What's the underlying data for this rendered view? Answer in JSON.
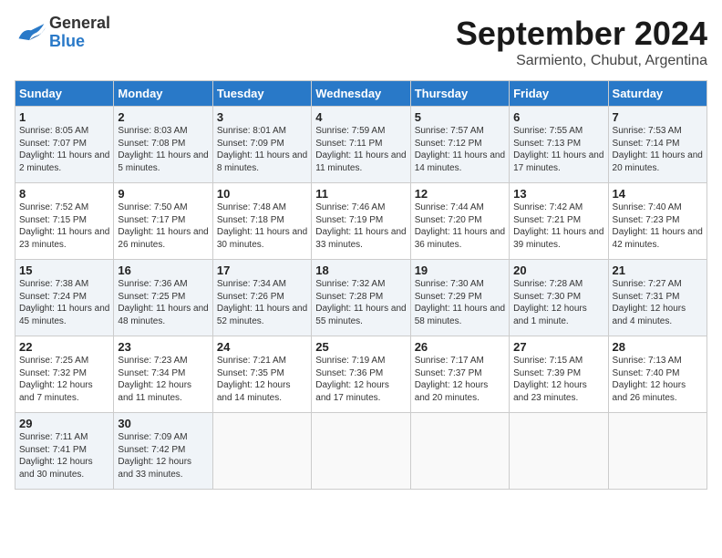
{
  "header": {
    "logo_general": "General",
    "logo_blue": "Blue",
    "month": "September 2024",
    "location": "Sarmiento, Chubut, Argentina"
  },
  "columns": [
    "Sunday",
    "Monday",
    "Tuesday",
    "Wednesday",
    "Thursday",
    "Friday",
    "Saturday"
  ],
  "weeks": [
    [
      {
        "day": "1",
        "sunrise": "8:05 AM",
        "sunset": "7:07 PM",
        "daylight": "11 hours and 2 minutes."
      },
      {
        "day": "2",
        "sunrise": "8:03 AM",
        "sunset": "7:08 PM",
        "daylight": "11 hours and 5 minutes."
      },
      {
        "day": "3",
        "sunrise": "8:01 AM",
        "sunset": "7:09 PM",
        "daylight": "11 hours and 8 minutes."
      },
      {
        "day": "4",
        "sunrise": "7:59 AM",
        "sunset": "7:11 PM",
        "daylight": "11 hours and 11 minutes."
      },
      {
        "day": "5",
        "sunrise": "7:57 AM",
        "sunset": "7:12 PM",
        "daylight": "11 hours and 14 minutes."
      },
      {
        "day": "6",
        "sunrise": "7:55 AM",
        "sunset": "7:13 PM",
        "daylight": "11 hours and 17 minutes."
      },
      {
        "day": "7",
        "sunrise": "7:53 AM",
        "sunset": "7:14 PM",
        "daylight": "11 hours and 20 minutes."
      }
    ],
    [
      {
        "day": "8",
        "sunrise": "7:52 AM",
        "sunset": "7:15 PM",
        "daylight": "11 hours and 23 minutes."
      },
      {
        "day": "9",
        "sunrise": "7:50 AM",
        "sunset": "7:17 PM",
        "daylight": "11 hours and 26 minutes."
      },
      {
        "day": "10",
        "sunrise": "7:48 AM",
        "sunset": "7:18 PM",
        "daylight": "11 hours and 30 minutes."
      },
      {
        "day": "11",
        "sunrise": "7:46 AM",
        "sunset": "7:19 PM",
        "daylight": "11 hours and 33 minutes."
      },
      {
        "day": "12",
        "sunrise": "7:44 AM",
        "sunset": "7:20 PM",
        "daylight": "11 hours and 36 minutes."
      },
      {
        "day": "13",
        "sunrise": "7:42 AM",
        "sunset": "7:21 PM",
        "daylight": "11 hours and 39 minutes."
      },
      {
        "day": "14",
        "sunrise": "7:40 AM",
        "sunset": "7:23 PM",
        "daylight": "11 hours and 42 minutes."
      }
    ],
    [
      {
        "day": "15",
        "sunrise": "7:38 AM",
        "sunset": "7:24 PM",
        "daylight": "11 hours and 45 minutes."
      },
      {
        "day": "16",
        "sunrise": "7:36 AM",
        "sunset": "7:25 PM",
        "daylight": "11 hours and 48 minutes."
      },
      {
        "day": "17",
        "sunrise": "7:34 AM",
        "sunset": "7:26 PM",
        "daylight": "11 hours and 52 minutes."
      },
      {
        "day": "18",
        "sunrise": "7:32 AM",
        "sunset": "7:28 PM",
        "daylight": "11 hours and 55 minutes."
      },
      {
        "day": "19",
        "sunrise": "7:30 AM",
        "sunset": "7:29 PM",
        "daylight": "11 hours and 58 minutes."
      },
      {
        "day": "20",
        "sunrise": "7:28 AM",
        "sunset": "7:30 PM",
        "daylight": "12 hours and 1 minute."
      },
      {
        "day": "21",
        "sunrise": "7:27 AM",
        "sunset": "7:31 PM",
        "daylight": "12 hours and 4 minutes."
      }
    ],
    [
      {
        "day": "22",
        "sunrise": "7:25 AM",
        "sunset": "7:32 PM",
        "daylight": "12 hours and 7 minutes."
      },
      {
        "day": "23",
        "sunrise": "7:23 AM",
        "sunset": "7:34 PM",
        "daylight": "12 hours and 11 minutes."
      },
      {
        "day": "24",
        "sunrise": "7:21 AM",
        "sunset": "7:35 PM",
        "daylight": "12 hours and 14 minutes."
      },
      {
        "day": "25",
        "sunrise": "7:19 AM",
        "sunset": "7:36 PM",
        "daylight": "12 hours and 17 minutes."
      },
      {
        "day": "26",
        "sunrise": "7:17 AM",
        "sunset": "7:37 PM",
        "daylight": "12 hours and 20 minutes."
      },
      {
        "day": "27",
        "sunrise": "7:15 AM",
        "sunset": "7:39 PM",
        "daylight": "12 hours and 23 minutes."
      },
      {
        "day": "28",
        "sunrise": "7:13 AM",
        "sunset": "7:40 PM",
        "daylight": "12 hours and 26 minutes."
      }
    ],
    [
      {
        "day": "29",
        "sunrise": "7:11 AM",
        "sunset": "7:41 PM",
        "daylight": "12 hours and 30 minutes."
      },
      {
        "day": "30",
        "sunrise": "7:09 AM",
        "sunset": "7:42 PM",
        "daylight": "12 hours and 33 minutes."
      },
      null,
      null,
      null,
      null,
      null
    ]
  ],
  "labels": {
    "sunrise_label": "Sunrise: ",
    "sunset_label": "Sunset: ",
    "daylight_label": "Daylight: "
  }
}
